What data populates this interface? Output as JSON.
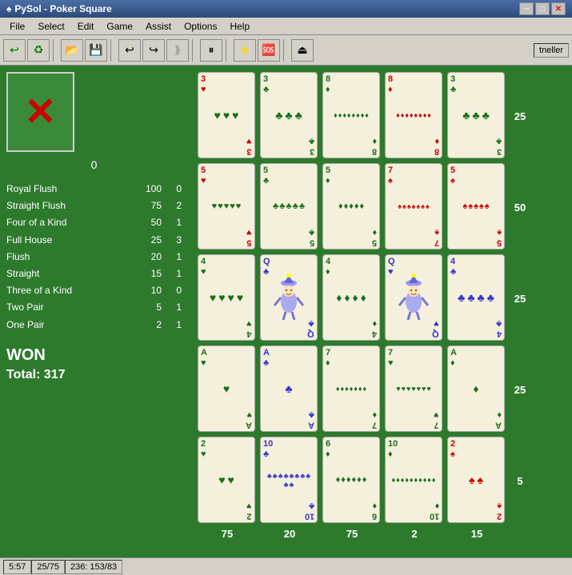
{
  "window": {
    "title": "PySol - Poker Square",
    "icon": "♠"
  },
  "menu": {
    "items": [
      "File",
      "Select",
      "Edit",
      "Game",
      "Assist",
      "Options",
      "Help"
    ]
  },
  "toolbar": {
    "buttons": [
      "↩",
      "♻",
      "📁",
      "💾",
      "↩",
      "↪",
      "⟫",
      "⏸",
      "★",
      "🔄",
      "⏏"
    ],
    "user": "tneller"
  },
  "empty_slot": {
    "label": "0"
  },
  "scoring": {
    "rows": [
      {
        "name": "Royal Flush",
        "pts": 100,
        "count": 0
      },
      {
        "name": "Straight Flush",
        "pts": 75,
        "count": 2
      },
      {
        "name": "Four of a Kind",
        "pts": 50,
        "count": 1
      },
      {
        "name": "Full House",
        "pts": 25,
        "count": 3
      },
      {
        "name": "Flush",
        "pts": 20,
        "count": 1
      },
      {
        "name": "Straight",
        "pts": 15,
        "count": 1
      },
      {
        "name": "Three of a Kind",
        "pts": 10,
        "count": 0
      },
      {
        "name": "Two Pair",
        "pts": 5,
        "count": 1
      },
      {
        "name": "One Pair",
        "pts": 2,
        "count": 1
      }
    ]
  },
  "result": {
    "status": "WON",
    "total_label": "Total: 317"
  },
  "row_scores": [
    25,
    50,
    25,
    25,
    5
  ],
  "col_scores": [
    75,
    20,
    75,
    2,
    15
  ],
  "status_bar": {
    "time": "5:57",
    "moves": "25/75",
    "coords": "236: 153/83"
  },
  "cards": [
    {
      "rank": "3",
      "suit": "♥",
      "color": "red",
      "pips": 3
    },
    {
      "rank": "3",
      "suit": "♣",
      "color": "green",
      "pips": 3
    },
    {
      "rank": "8",
      "suit": "♦",
      "color": "green",
      "pips": 8
    },
    {
      "rank": "8",
      "suit": "♦",
      "color": "red",
      "pips": 8
    },
    {
      "rank": "3",
      "suit": "♣",
      "color": "green",
      "pips": 3
    },
    {
      "rank": "5",
      "suit": "♥",
      "color": "red",
      "pips": 5
    },
    {
      "rank": "5",
      "suit": "♣",
      "color": "green",
      "pips": 5
    },
    {
      "rank": "5",
      "suit": "♦",
      "color": "green",
      "pips": 5
    },
    {
      "rank": "7",
      "suit": "♠",
      "color": "red",
      "pips": 7
    },
    {
      "rank": "5",
      "suit": "♠",
      "color": "red",
      "pips": 5
    },
    {
      "rank": "4",
      "suit": "♥",
      "color": "green",
      "pips": 4
    },
    {
      "rank": "Q",
      "suit": "♣",
      "color": "blue",
      "pips": 0,
      "joker": true
    },
    {
      "rank": "4",
      "suit": "♦",
      "color": "green",
      "pips": 4
    },
    {
      "rank": "Q",
      "suit": "♥",
      "color": "blue",
      "pips": 0,
      "joker": true
    },
    {
      "rank": "4",
      "suit": "♣",
      "color": "blue",
      "pips": 4
    },
    {
      "rank": "A",
      "suit": "♥",
      "color": "green",
      "pips": 1
    },
    {
      "rank": "A",
      "suit": "♣",
      "color": "blue",
      "pips": 1
    },
    {
      "rank": "7",
      "suit": "♦",
      "color": "green",
      "pips": 7
    },
    {
      "rank": "7",
      "suit": "♥",
      "color": "green",
      "pips": 7
    },
    {
      "rank": "A",
      "suit": "♦",
      "color": "green",
      "pips": 1
    },
    {
      "rank": "2",
      "suit": "♥",
      "color": "green",
      "pips": 2
    },
    {
      "rank": "10",
      "suit": "♣",
      "color": "blue",
      "pips": 10
    },
    {
      "rank": "6",
      "suit": "♦",
      "color": "green",
      "pips": 6
    },
    {
      "rank": "10",
      "suit": "♦",
      "color": "green",
      "pips": 10
    },
    {
      "rank": "2",
      "suit": "♠",
      "color": "red",
      "pips": 2
    }
  ]
}
